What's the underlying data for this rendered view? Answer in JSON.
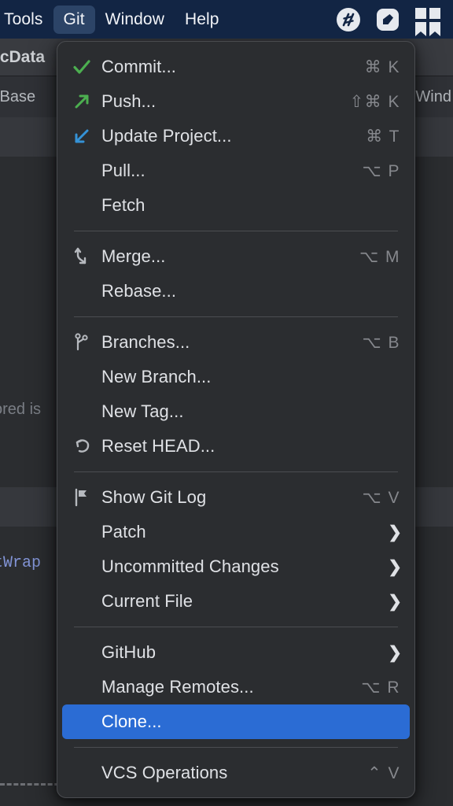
{
  "menubar": {
    "items": [
      {
        "label": "Tools",
        "active": false
      },
      {
        "label": "Git",
        "active": true
      },
      {
        "label": "Window",
        "active": false
      },
      {
        "label": "Help",
        "active": false
      }
    ],
    "tray_icons": [
      "hyper-icon",
      "evernote-icon",
      "bookmark-icon"
    ],
    "background": "#122544",
    "active_background": "#2c4467"
  },
  "background_ide": {
    "tab_title": "icData",
    "breadcrumb_left": "tBase",
    "breadcrumb_right": "nWind",
    "code_comment": "ored is",
    "code_keyword": "tWrap"
  },
  "menu": {
    "accent": "#2b6cd4",
    "background": "#2b2d30",
    "groups": [
      {
        "items": [
          {
            "label": "Commit...",
            "shortcut": "⌘ K",
            "icon": "checkmark-icon",
            "submenu": false
          },
          {
            "label": "Push...",
            "shortcut": "⇧⌘ K",
            "icon": "arrow-up-right-icon",
            "submenu": false
          },
          {
            "label": "Update Project...",
            "shortcut": "⌘ T",
            "icon": "arrow-down-left-icon",
            "submenu": false
          },
          {
            "label": "Pull...",
            "shortcut": "⌥ P",
            "icon": "",
            "submenu": false
          },
          {
            "label": "Fetch",
            "shortcut": "",
            "icon": "",
            "submenu": false
          }
        ]
      },
      {
        "items": [
          {
            "label": "Merge...",
            "shortcut": "⌥ M",
            "icon": "merge-icon",
            "submenu": false
          },
          {
            "label": "Rebase...",
            "shortcut": "",
            "icon": "",
            "submenu": false
          }
        ]
      },
      {
        "items": [
          {
            "label": "Branches...",
            "shortcut": "⌥ B",
            "icon": "branch-icon",
            "submenu": false
          },
          {
            "label": "New Branch...",
            "shortcut": "",
            "icon": "",
            "submenu": false
          },
          {
            "label": "New Tag...",
            "shortcut": "",
            "icon": "",
            "submenu": false
          },
          {
            "label": "Reset HEAD...",
            "shortcut": "",
            "icon": "reset-icon",
            "submenu": false
          }
        ]
      },
      {
        "items": [
          {
            "label": "Show Git Log",
            "shortcut": "⌥ V",
            "icon": "git-log-icon",
            "submenu": false
          },
          {
            "label": "Patch",
            "shortcut": "",
            "icon": "",
            "submenu": true
          },
          {
            "label": "Uncommitted Changes",
            "shortcut": "",
            "icon": "",
            "submenu": true
          },
          {
            "label": "Current File",
            "shortcut": "",
            "icon": "",
            "submenu": true
          }
        ]
      },
      {
        "items": [
          {
            "label": "GitHub",
            "shortcut": "",
            "icon": "",
            "submenu": true
          },
          {
            "label": "Manage Remotes...",
            "shortcut": "⌥ R",
            "icon": "",
            "submenu": false
          },
          {
            "label": "Clone...",
            "shortcut": "",
            "icon": "",
            "submenu": false,
            "selected": true
          }
        ]
      },
      {
        "items": [
          {
            "label": "VCS Operations",
            "shortcut": "⌃ V",
            "icon": "",
            "submenu": false
          }
        ]
      }
    ]
  }
}
